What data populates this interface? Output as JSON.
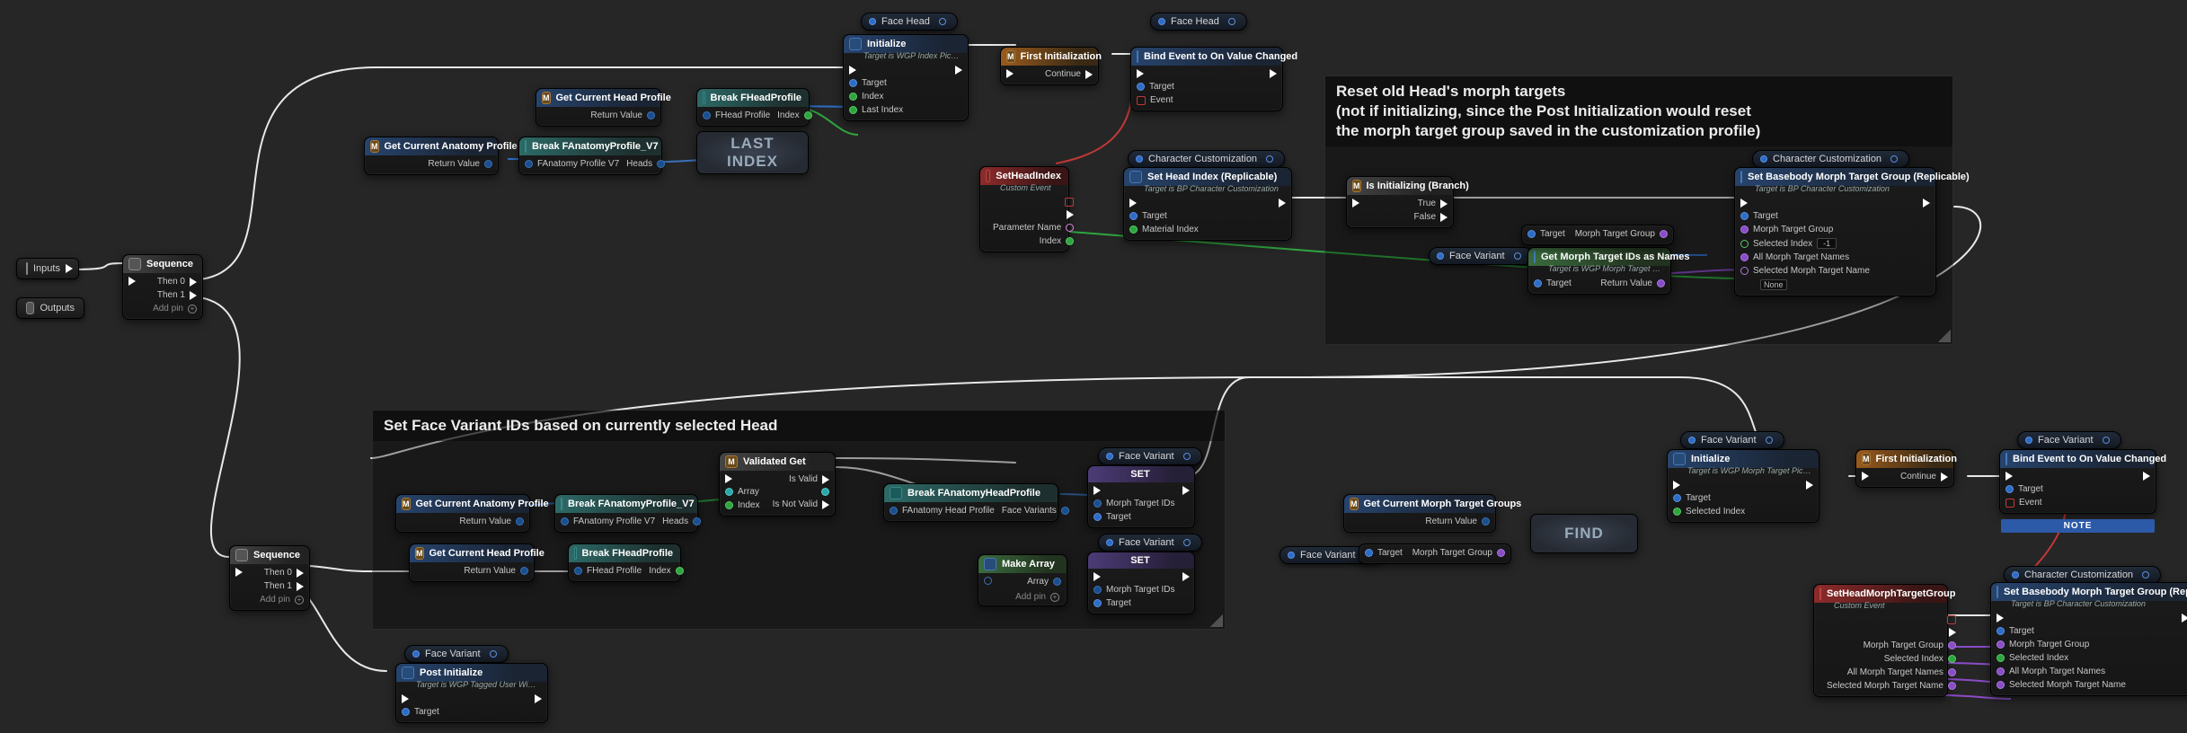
{
  "comments": {
    "reset": "Reset old Head's morph targets\n(not if initializing, since the Post Initialization would reset\nthe morph target group saved in the customization profile)",
    "setFace": "Set Face Variant IDs based on currently selected Head"
  },
  "tunnels": {
    "inputs": "Inputs",
    "outputs": "Outputs"
  },
  "sequence": {
    "title": "Sequence",
    "then0": "Then 0",
    "then1": "Then 1",
    "addpin": "Add pin"
  },
  "vars": {
    "faceHead": "Face Head",
    "characterCustomization": "Character Customization",
    "faceVariant": "Face Variant"
  },
  "nodes": {
    "getCurrentHeadProfile": {
      "title": "Get Current Head Profile",
      "returnValue": "Return Value"
    },
    "getCurrentAnatomyProfile": {
      "title": "Get Current Anatomy Profile",
      "returnValue": "Return Value"
    },
    "breakFHeadProfile": {
      "title": "Break FHeadProfile",
      "in": "FHead Profile",
      "out": "Index"
    },
    "breakFAnatomyProfile": {
      "title": "Break FAnatomyProfile_V7",
      "in": "FAnatomy Profile V7",
      "out": "Heads"
    },
    "lastIndex": "LAST\nINDEX",
    "initialize": {
      "title": "Initialize",
      "sub": "Target is WGP Index Picker",
      "target": "Target",
      "index": "Index",
      "lastIndex": "Last Index"
    },
    "firstInit": {
      "title": "First Initialization",
      "continue": "Continue"
    },
    "bindEvent": {
      "title": "Bind Event to On Value Changed",
      "target": "Target",
      "event": "Event"
    },
    "setHeadIndexEv": {
      "title": "SetHeadIndex",
      "sub": "Custom Event",
      "parameterName": "Parameter Name",
      "index": "Index"
    },
    "setHeadIndexRep": {
      "title": "Set Head Index (Replicable)",
      "sub": "Target is BP Character Customization",
      "target": "Target",
      "materialIndex": "Material Index"
    },
    "isInitializing": {
      "title": "Is Initializing (Branch)",
      "true": "True",
      "false": "False"
    },
    "getMorphIds": {
      "title": "Get Morph Target IDs as Names",
      "sub": "Target is WGP Morph Target Picker",
      "target": "Target",
      "returnValue": "Return Value"
    },
    "setBasebody": {
      "title": "Set Basebody Morph Target Group (Replicable)",
      "sub": "Target is BP Character Customization",
      "target": "Target",
      "morphTargetGroup": "Morph Target Group",
      "selectedIndex": "Selected Index",
      "selectedIndexVal": "-1",
      "allMorphNames": "All Morph Target Names",
      "selectedMorphName": "Selected Morph Target Name",
      "selectedMorphVal": "None"
    },
    "validatedGet": {
      "title": "Validated Get",
      "array": "Array",
      "index": "Index",
      "isValid": "Is Valid",
      "isNotValid": "Is Not Valid"
    },
    "breakFAnatomyHead": {
      "title": "Break FAnatomyHeadProfile",
      "in": "FAnatomy Head Profile",
      "out": "Face Variants"
    },
    "set": {
      "title": "SET",
      "morphIds": "Morph Target IDs",
      "target": "Target"
    },
    "makeArray": {
      "title": "Make Array",
      "array": "Array",
      "addpin": "Add pin"
    },
    "postInit": {
      "title": "Post Initialize",
      "sub": "Target is WGP Tagged User Widget",
      "target": "Target"
    },
    "getCurrentMorphGroups": {
      "title": "Get Current Morph Target Groups",
      "returnValue": "Return Value"
    },
    "find": "FIND",
    "initialize2": {
      "title": "Initialize",
      "sub": "Target is WGP Morph Target Picker",
      "target": "Target",
      "selectedIndex": "Selected Index"
    },
    "setHeadMorph": {
      "title": "SetHeadMorphTargetGroup",
      "sub": "Custom Event",
      "morphTargetGroup": "Morph Target Group",
      "selectedIndex": "Selected Index",
      "allMorphNames": "All Morph Target Names",
      "selectedMorphName": "Selected Morph Target Name"
    },
    "note": "NOTE"
  },
  "pins": {
    "target": "Target",
    "morphTargetGroup": "Morph Target Group"
  }
}
